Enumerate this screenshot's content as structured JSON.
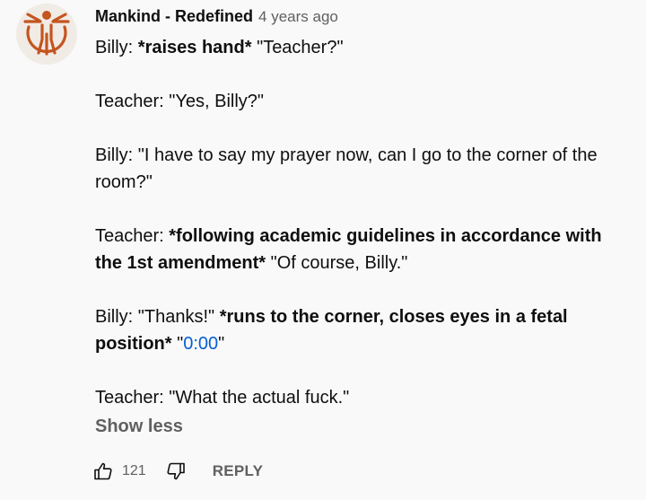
{
  "comment": {
    "author": "Mankind - Redefined",
    "time": "4 years ago",
    "brand_color": "#c4551f",
    "p1": {
      "a": "Billy: ",
      "b": "*raises hand*",
      "c": " \"Teacher?\""
    },
    "p2": "Teacher: \"Yes, Billy?\"",
    "p3": "Billy: \"I have to say my prayer now, can I go to the corner of the room?\"",
    "p4": {
      "a": "Teacher: ",
      "b": "*following academic guidelines in accordance with the 1st amendment*",
      "c": " \"Of course, Billy.\""
    },
    "p5": {
      "a": "Billy: \"Thanks!\" ",
      "b": "*runs to the corner, closes eyes in a fetal position*",
      "c": " \"",
      "link": "0:00",
      "d": "\""
    },
    "p6": "Teacher: \"What the actual fuck.\"",
    "show_less": "Show less"
  },
  "actions": {
    "like_icon": "thumb-up-icon",
    "like_count": "121",
    "dislike_icon": "thumb-down-icon",
    "reply_label": "REPLY"
  }
}
